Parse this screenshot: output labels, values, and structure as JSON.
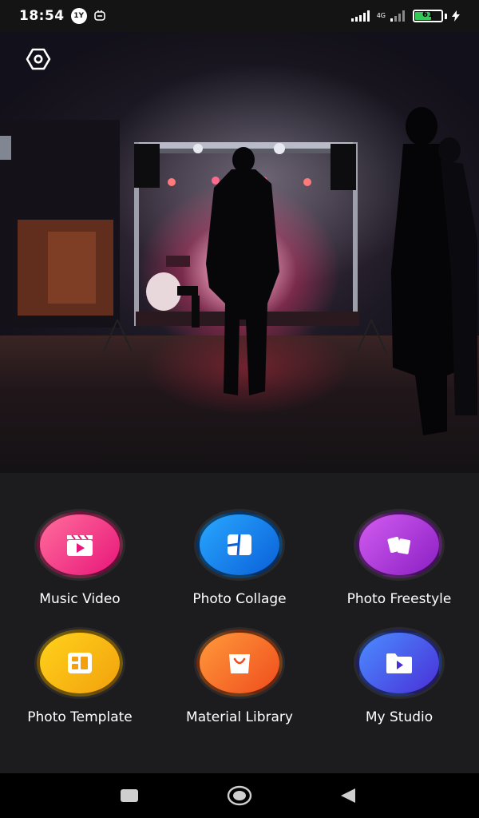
{
  "status_bar": {
    "time": "18:54",
    "badge": "1Y",
    "network": "4G",
    "battery": "61",
    "battery_level": 0.61,
    "icons": [
      "notification-icon",
      "signal-icon",
      "signal-4g-icon",
      "battery-icon",
      "charging-icon"
    ]
  },
  "hero": {
    "settings_icon": "settings-icon"
  },
  "features": [
    {
      "label": "Music Video",
      "icon": "clapperboard-play-icon",
      "gradient": [
        "#ff6e9c",
        "#e8157a"
      ]
    },
    {
      "label": "Photo Collage",
      "icon": "collage-icon",
      "gradient": [
        "#29a8ff",
        "#0a5fd8"
      ]
    },
    {
      "label": "Photo Freestyle",
      "icon": "freestyle-cards-icon",
      "gradient": [
        "#d25cf0",
        "#8a1fc4"
      ]
    },
    {
      "label": "Photo Template",
      "icon": "template-icon",
      "gradient": [
        "#ffd21c",
        "#f2a10c"
      ]
    },
    {
      "label": "Material Library",
      "icon": "shopping-bag-icon",
      "gradient": [
        "#ff9a3c",
        "#f04c1c"
      ]
    },
    {
      "label": "My Studio",
      "icon": "folder-play-icon",
      "gradient": [
        "#4b8dff",
        "#4a2fd8"
      ]
    }
  ],
  "nav": {
    "icons": [
      "recents-icon",
      "home-icon",
      "back-icon"
    ]
  }
}
